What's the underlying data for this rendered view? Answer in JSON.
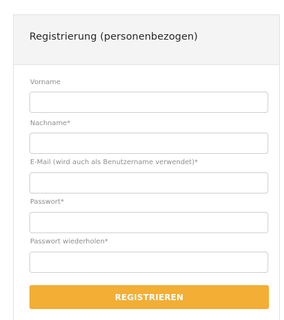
{
  "card": {
    "title": "Registrierung (personenbezogen)"
  },
  "form": {
    "fields": [
      {
        "label": "Vorname",
        "value": "",
        "placeholder": ""
      },
      {
        "label": "Nachname*",
        "value": "",
        "placeholder": ""
      },
      {
        "label": "E-Mail (wird auch als Benutzername verwendet)*",
        "value": "",
        "placeholder": ""
      },
      {
        "label": "Passwort*",
        "value": "",
        "placeholder": ""
      },
      {
        "label": "Passwort wiederholen*",
        "value": "",
        "placeholder": ""
      }
    ],
    "submit_label": "REGISTRIEREN"
  },
  "colors": {
    "accent": "#f2ae35",
    "header_bg": "#f4f4f4",
    "label": "#8d8d8d",
    "border": "#cfcfcf"
  }
}
